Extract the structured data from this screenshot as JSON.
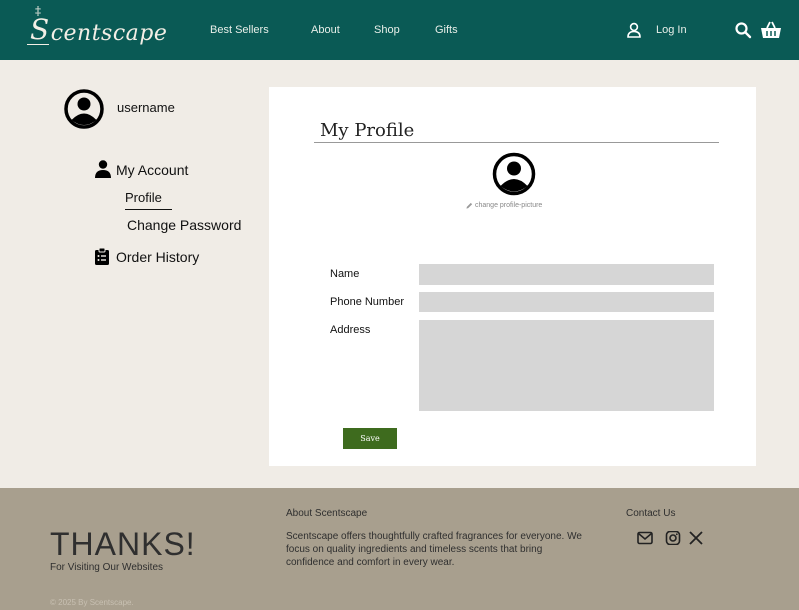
{
  "header": {
    "logo": "Scentscape",
    "nav": [
      "Best Sellers",
      "About",
      "Shop",
      "Gifts"
    ],
    "login_label": "Log In",
    "icons": [
      "user-icon",
      "search-icon",
      "basket-icon"
    ],
    "bg_color": "#0a5a55"
  },
  "sidebar": {
    "username": "username",
    "my_account": "My Account",
    "profile": "Profile",
    "change_password": "Change Password",
    "order_history": "Order History"
  },
  "profile": {
    "title": "My Profile",
    "change_picture": "change profile-picture",
    "labels": {
      "name": "Name",
      "phone": "Phone Number",
      "address": "Address"
    },
    "values": {
      "name": "",
      "phone": "",
      "address": ""
    },
    "save_label": "Save",
    "save_color": "#3e6b1e"
  },
  "footer": {
    "thanks": "THANKS!",
    "visiting": "For Visiting Our Websites",
    "copyright": "© 2025 By Scentscape.",
    "about_heading": "About Scentscape",
    "about_text": "Scentscape offers thoughtfully crafted fragrances for everyone. We focus on quality ingredients and timeless scents that bring confidence and comfort in every wear.",
    "contact_heading": "Contact Us",
    "social_icons": [
      "mail-icon",
      "instagram-icon",
      "x-icon"
    ],
    "bg_color": "#a89f8e"
  }
}
